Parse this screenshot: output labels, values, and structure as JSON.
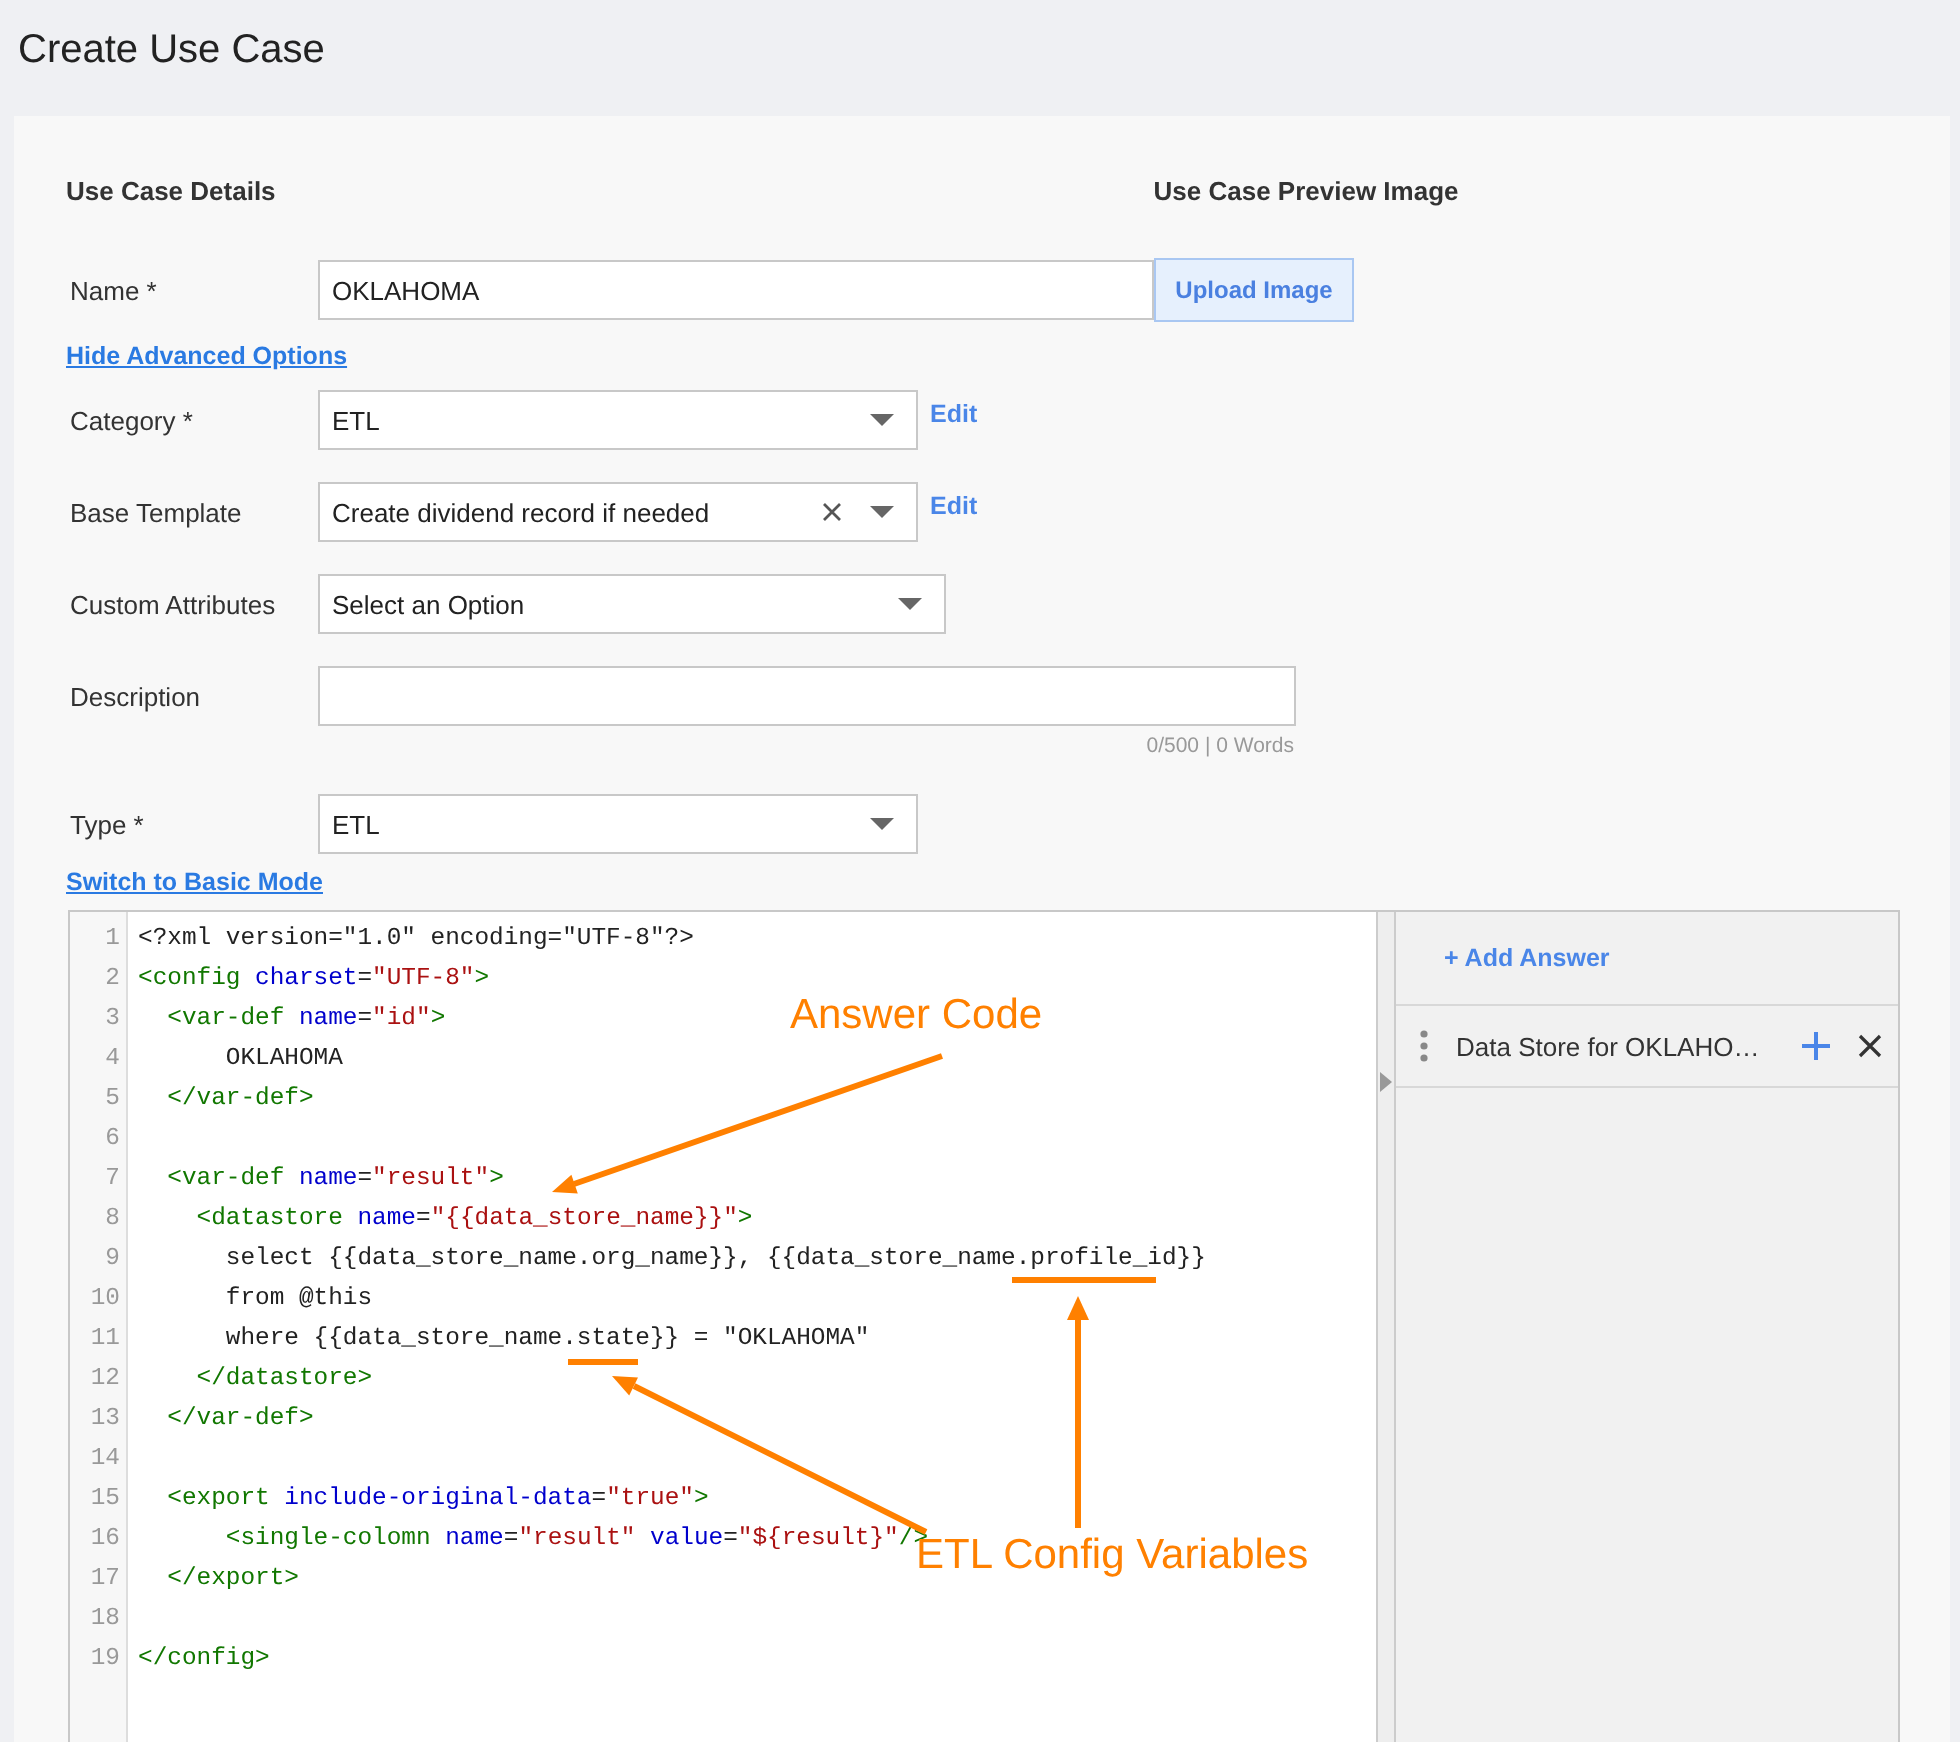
{
  "page": {
    "title": "Create Use Case"
  },
  "details": {
    "heading": "Use Case Details",
    "preview_heading": "Use Case Preview Image"
  },
  "form": [
    {
      "kind": "input",
      "label": "Name *",
      "value": "OKLAHOMA",
      "button": "Upload Image"
    },
    {
      "kind": "link",
      "text": "Hide Advanced Options"
    },
    {
      "kind": "select",
      "label": "Category *",
      "value": "ETL",
      "clearable": false,
      "edit_link": "Edit"
    },
    {
      "kind": "select",
      "label": "Base Template",
      "value": "Create dividend record if needed",
      "clearable": true,
      "edit_link": "Edit"
    },
    {
      "kind": "select",
      "label": "Custom Attributes",
      "placeholder": "Select an Option",
      "clearable": false
    },
    {
      "kind": "textarea",
      "label": "Description",
      "counter": "0/500 | 0 Words"
    },
    {
      "kind": "select",
      "label": "Type *",
      "value": "ETL",
      "clearable": false
    },
    {
      "kind": "link",
      "text": "Switch to Basic Mode"
    }
  ],
  "editor": {
    "lines": [
      {
        "number": "1",
        "tokens": [
          {
            "kind": "text",
            "text": "<?xml version=\"1.0\" encoding=\"UTF-8\"?>"
          }
        ]
      },
      {
        "number": "2",
        "tokens": [
          {
            "kind": "tag",
            "text": "<config "
          },
          {
            "kind": "attr",
            "text": "charset"
          },
          {
            "kind": "text",
            "text": "="
          },
          {
            "kind": "str",
            "text": "\"UTF-8\""
          },
          {
            "kind": "tag",
            "text": ">"
          }
        ]
      },
      {
        "number": "3",
        "tokens": [
          {
            "kind": "tag",
            "text": "  <var-def "
          },
          {
            "kind": "attr",
            "text": "name"
          },
          {
            "kind": "text",
            "text": "="
          },
          {
            "kind": "str",
            "text": "\"id\""
          },
          {
            "kind": "tag",
            "text": ">"
          }
        ]
      },
      {
        "number": "4",
        "tokens": [
          {
            "kind": "text",
            "text": "      OKLAHOMA"
          }
        ]
      },
      {
        "number": "5",
        "tokens": [
          {
            "kind": "tag",
            "text": "  </var-def>"
          }
        ]
      },
      {
        "number": "6"
      },
      {
        "number": "7",
        "tokens": [
          {
            "kind": "tag",
            "text": "  <var-def "
          },
          {
            "kind": "attr",
            "text": "name"
          },
          {
            "kind": "text",
            "text": "="
          },
          {
            "kind": "str",
            "text": "\"result\""
          },
          {
            "kind": "tag",
            "text": ">"
          }
        ]
      },
      {
        "number": "8",
        "tokens": [
          {
            "kind": "tag",
            "text": "    <datastore "
          },
          {
            "kind": "attr",
            "text": "name"
          },
          {
            "kind": "text",
            "text": "="
          },
          {
            "kind": "str",
            "text": "\"{{data_store_name}}\""
          },
          {
            "kind": "tag",
            "text": ">"
          }
        ]
      },
      {
        "number": "9",
        "tokens": [
          {
            "kind": "text",
            "text": "      select {{data_store_name.org_name}}, {{data_store_name.profile_id}}"
          }
        ]
      },
      {
        "number": "10",
        "tokens": [
          {
            "kind": "text",
            "text": "      from @this"
          }
        ]
      },
      {
        "number": "11",
        "tokens": [
          {
            "kind": "text",
            "text": "      where {{data_store_name.state}} = \"OKLAHOMA\""
          }
        ]
      },
      {
        "number": "12",
        "tokens": [
          {
            "kind": "tag",
            "text": "    </datastore>"
          }
        ]
      },
      {
        "number": "13",
        "tokens": [
          {
            "kind": "tag",
            "text": "  </var-def>"
          }
        ]
      },
      {
        "number": "14"
      },
      {
        "number": "15",
        "tokens": [
          {
            "kind": "tag",
            "text": "  <export "
          },
          {
            "kind": "attr",
            "text": "include-original-data"
          },
          {
            "kind": "text",
            "text": "="
          },
          {
            "kind": "str",
            "text": "\"true\""
          },
          {
            "kind": "tag",
            "text": ">"
          }
        ]
      },
      {
        "number": "16",
        "tokens": [
          {
            "kind": "tag",
            "text": "      <single-colomn "
          },
          {
            "kind": "attr",
            "text": "name"
          },
          {
            "kind": "text",
            "text": "="
          },
          {
            "kind": "str",
            "text": "\"result\" "
          },
          {
            "kind": "attr",
            "text": "value"
          },
          {
            "kind": "text",
            "text": "="
          },
          {
            "kind": "str",
            "text": "\"${result}\""
          },
          {
            "kind": "tag",
            "text": "/>"
          }
        ]
      },
      {
        "number": "17",
        "tokens": [
          {
            "kind": "tag",
            "text": "  </export>"
          }
        ]
      },
      {
        "number": "18"
      },
      {
        "number": "19",
        "tokens": [
          {
            "kind": "tag",
            "text": "</config>"
          }
        ]
      }
    ],
    "annotations": [
      {
        "text": "Answer Code"
      },
      {
        "text": "ETL Config Variables"
      }
    ]
  },
  "answers": {
    "add_button": "+ Add Answer",
    "items": [
      {
        "name": "Data Store for OKLAHO…"
      }
    ]
  }
}
